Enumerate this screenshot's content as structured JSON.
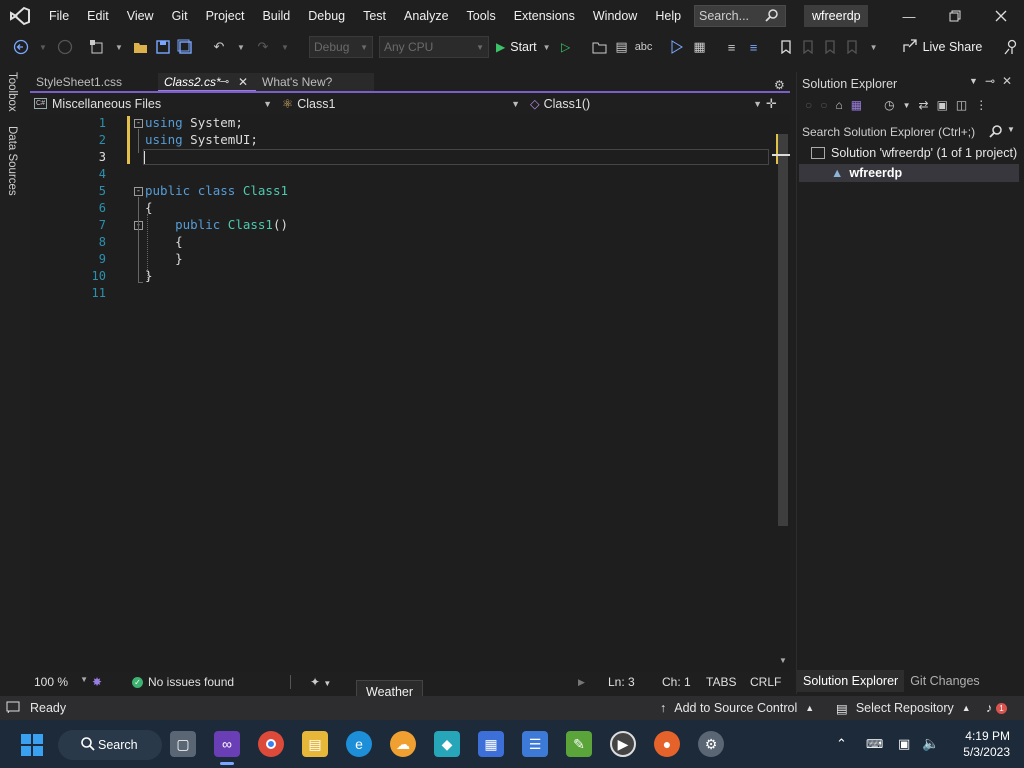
{
  "menu": [
    "File",
    "Edit",
    "View",
    "Git",
    "Project",
    "Build",
    "Debug",
    "Test",
    "Analyze",
    "Tools",
    "Extensions",
    "Window",
    "Help"
  ],
  "title_search": {
    "placeholder": "Search..."
  },
  "solution_name": "wfreerdp",
  "toolbar": {
    "config": "Debug",
    "platform": "Any CPU",
    "start_label": "Start",
    "live_share": "Live Share"
  },
  "side_tabs": [
    "Toolbox",
    "Data Sources"
  ],
  "doc_tabs": [
    {
      "label": "StyleSheet1.css",
      "active": false
    },
    {
      "label": "Class2.cs*",
      "active": true
    },
    {
      "label": "What's New?",
      "active": false
    }
  ],
  "nav": {
    "project": "Miscellaneous Files",
    "type": "Class1",
    "member": "Class1()"
  },
  "code": {
    "line_numbers": [
      "1",
      "2",
      "3",
      "4",
      "5",
      "6",
      "7",
      "8",
      "9",
      "10",
      "11"
    ],
    "current_line": "3"
  },
  "editor_status": {
    "zoom": "100 %",
    "issues": "No issues found",
    "ln": "Ln: 3",
    "ch": "Ch: 1",
    "tabs": "TABS",
    "eol": "CRLF"
  },
  "solution_explorer": {
    "title": "Solution Explorer",
    "search_placeholder": "Search Solution Explorer (Ctrl+;)",
    "solution_label": "Solution 'wfreerdp' (1 of 1 project)",
    "project": "wfreerdp",
    "tabs": [
      "Solution Explorer",
      "Git Changes"
    ]
  },
  "statusbar": {
    "ready": "Ready",
    "add_source": "Add to Source Control",
    "select_repo": "Select Repository",
    "notif_count": "1"
  },
  "tooltip": "Weather",
  "taskbar": {
    "search_label": "Search",
    "time": "4:19 PM",
    "date": "5/3/2023"
  },
  "colors": {
    "accent": "#7a5fc7",
    "keyword": "#569cd6",
    "type": "#4ec9b0",
    "line_number": "#2b91af"
  }
}
